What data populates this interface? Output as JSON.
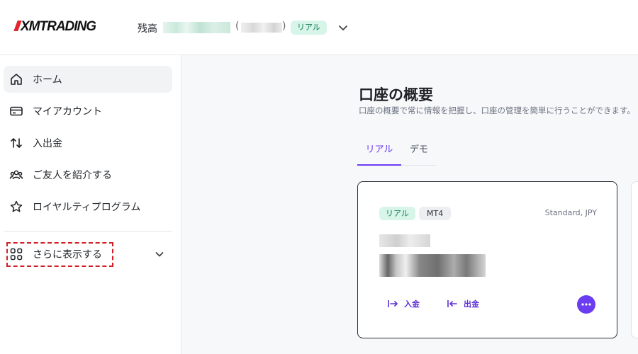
{
  "header": {
    "logo_text": "XMTRADING",
    "balance_label": "残高",
    "paren_open": "(",
    "paren_close": ")",
    "account_badge": "リアル"
  },
  "sidebar": {
    "items": [
      {
        "label": "ホーム",
        "icon": "home-icon",
        "active": true
      },
      {
        "label": "マイアカウント",
        "icon": "card-icon"
      },
      {
        "label": "入出金",
        "icon": "transfer-arrows-icon"
      },
      {
        "label": "ご友人を紹介する",
        "icon": "users-icon"
      },
      {
        "label": "ロイヤルティプログラム",
        "icon": "star-icon"
      }
    ],
    "more_label": "さらに表示する",
    "more_icon": "grid-icon"
  },
  "main": {
    "title": "口座の概要",
    "subtitle": "口座の概要で常に情報を把握し、口座の管理を簡単に行うことができます。",
    "tabs": [
      {
        "label": "リアル",
        "active": true
      },
      {
        "label": "デモ",
        "active": false
      }
    ],
    "account_card": {
      "badge_type": "リアル",
      "badge_platform": "MT4",
      "account_type": "Standard, JPY",
      "deposit_label": "入金",
      "withdraw_label": "出金"
    }
  },
  "colors": {
    "accent": "#6c3cf0",
    "badge_green_bg": "#d7f5e8",
    "badge_green_text": "#1a7f55",
    "highlight_red": "#d21f26"
  }
}
